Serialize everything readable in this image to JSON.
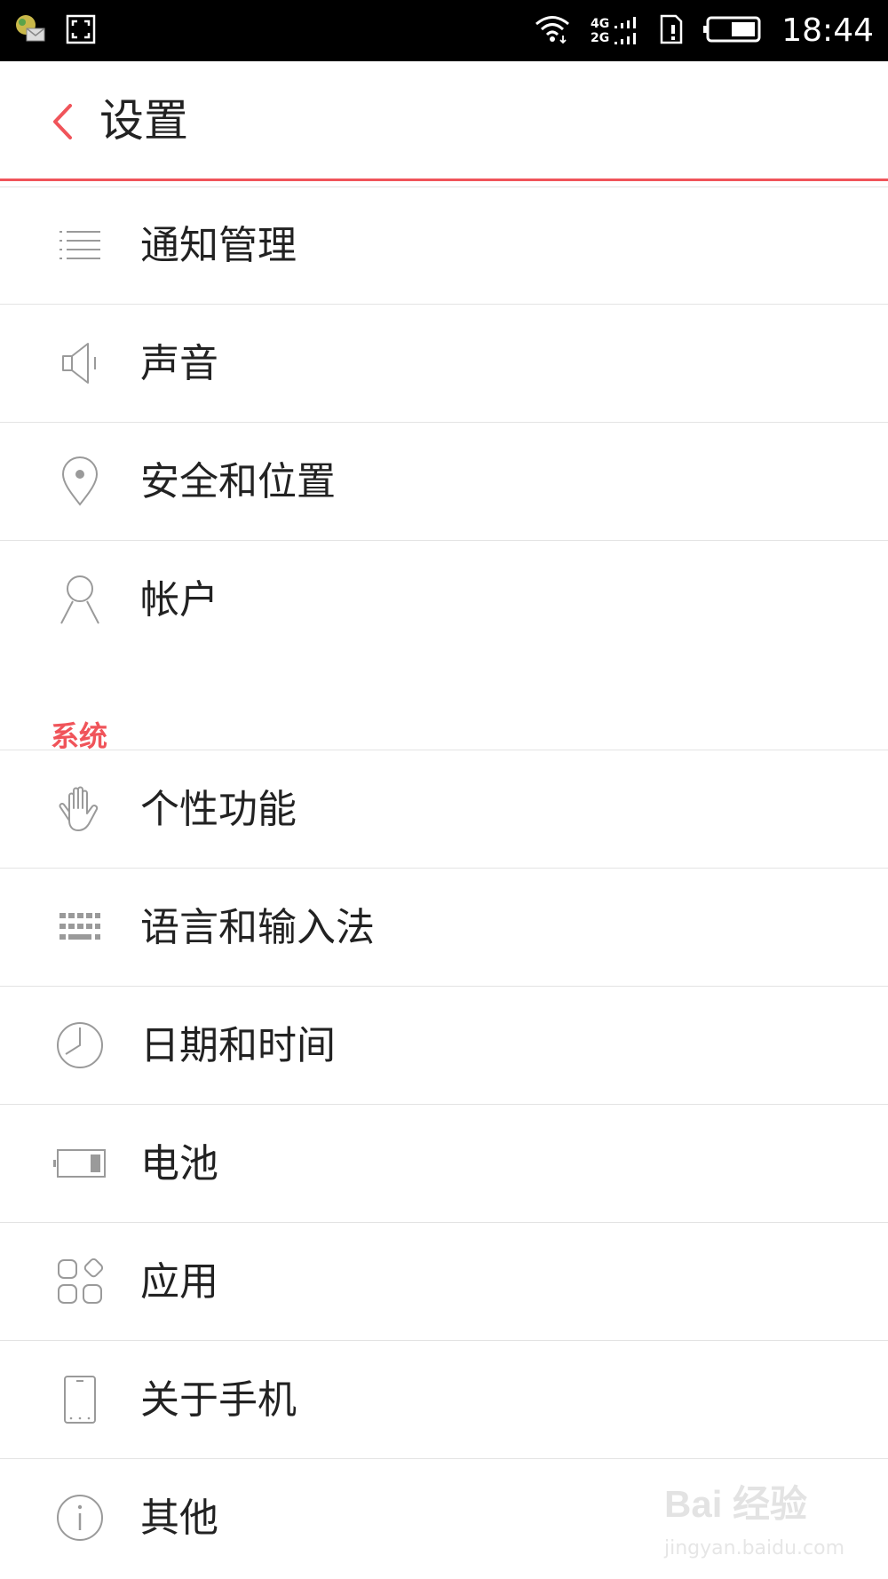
{
  "status_bar": {
    "time": "18:44",
    "network_top": "4G",
    "network_bottom": "2G",
    "icons": [
      "message-icon",
      "screenshot-icon",
      "wifi-icon",
      "signal-icon",
      "sim-icon",
      "battery-icon"
    ]
  },
  "header": {
    "title": "设置",
    "back_icon": "chevron-left-icon"
  },
  "colors": {
    "accent": "#f0545a",
    "text": "#222222",
    "divider": "#e3e3e3",
    "icon": "#9a9a9a"
  },
  "items_top": [
    {
      "label": "通知管理",
      "icon": "notification-list-icon"
    },
    {
      "label": "声音",
      "icon": "speaker-icon"
    },
    {
      "label": "安全和位置",
      "icon": "location-pin-icon"
    },
    {
      "label": "帐户",
      "icon": "account-icon"
    }
  ],
  "section": {
    "label": "系统"
  },
  "items_system": [
    {
      "label": "个性功能",
      "icon": "hand-icon"
    },
    {
      "label": "语言和输入法",
      "icon": "keyboard-icon"
    },
    {
      "label": "日期和时间",
      "icon": "clock-icon"
    },
    {
      "label": "电池",
      "icon": "battery-icon"
    },
    {
      "label": "应用",
      "icon": "apps-icon"
    },
    {
      "label": "关于手机",
      "icon": "phone-icon"
    },
    {
      "label": "其他",
      "icon": "info-icon"
    }
  ],
  "watermark": {
    "brand": "Bai 经验",
    "url": "jingyan.baidu.com"
  }
}
